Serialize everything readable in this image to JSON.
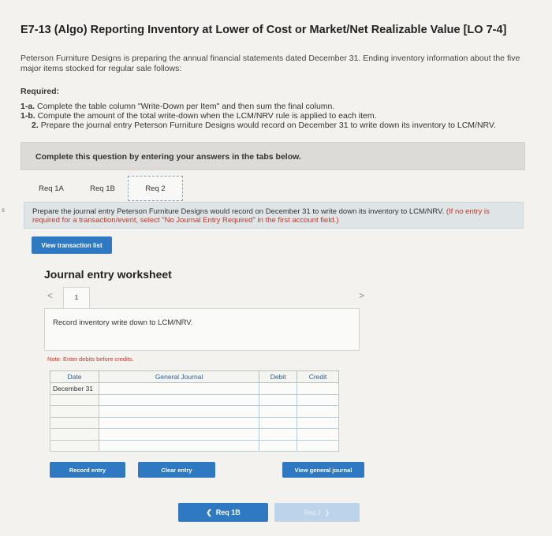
{
  "header": {
    "title": "E7-13 (Algo) Reporting Inventory at Lower of Cost or Market/Net Realizable Value [LO 7-4]"
  },
  "intro": {
    "text": "Peterson Furniture Designs is preparing the annual financial statements dated December 31. Ending inventory information about the five major items stocked for regular sale follows:"
  },
  "required": {
    "heading": "Required:",
    "items": [
      {
        "num": "1-a.",
        "text": "Complete the table column \"Write-Down per Item\" and then sum the final column."
      },
      {
        "num": "1-b.",
        "text": "Compute the amount of the total write-down when the LCM/NRV rule is applied to each item."
      },
      {
        "num": "2.",
        "text": "Prepare the journal entry Peterson Furniture Designs would record on December 31 to write down its inventory to LCM/NRV."
      }
    ]
  },
  "complete_bar": "Complete this question by entering your answers in the tabs below.",
  "tabs": [
    {
      "label": "Req 1A"
    },
    {
      "label": "Req 1B"
    },
    {
      "label": "Req 2",
      "active": true
    }
  ],
  "prompt": {
    "text": "Prepare the journal entry Peterson Furniture Designs would record on December 31 to write down its inventory to LCM/NRV.",
    "hint": "(If no entry is required for a transaction/event, select \"No Journal Entry Required\" in the first account field.)"
  },
  "view_transaction_label": "View transaction list",
  "worksheet": {
    "title": "Journal entry worksheet",
    "prev": "<",
    "next": ">",
    "page": "1",
    "description": "Record inventory write down to LCM/NRV.",
    "note": "Note: Enter debits before credits.",
    "columns": [
      "Date",
      "General Journal",
      "Debit",
      "Credit"
    ],
    "rows": [
      {
        "date": "December 31"
      },
      {
        "date": ""
      },
      {
        "date": ""
      },
      {
        "date": ""
      },
      {
        "date": ""
      },
      {
        "date": ""
      }
    ]
  },
  "buttons": {
    "record": "Record entry",
    "clear": "Clear entry",
    "view_journal": "View general journal"
  },
  "pager": {
    "prev": "Req 1B",
    "next": "Req 2"
  },
  "colors": {
    "accent": "#2f79c2",
    "note": "#c0392b"
  }
}
